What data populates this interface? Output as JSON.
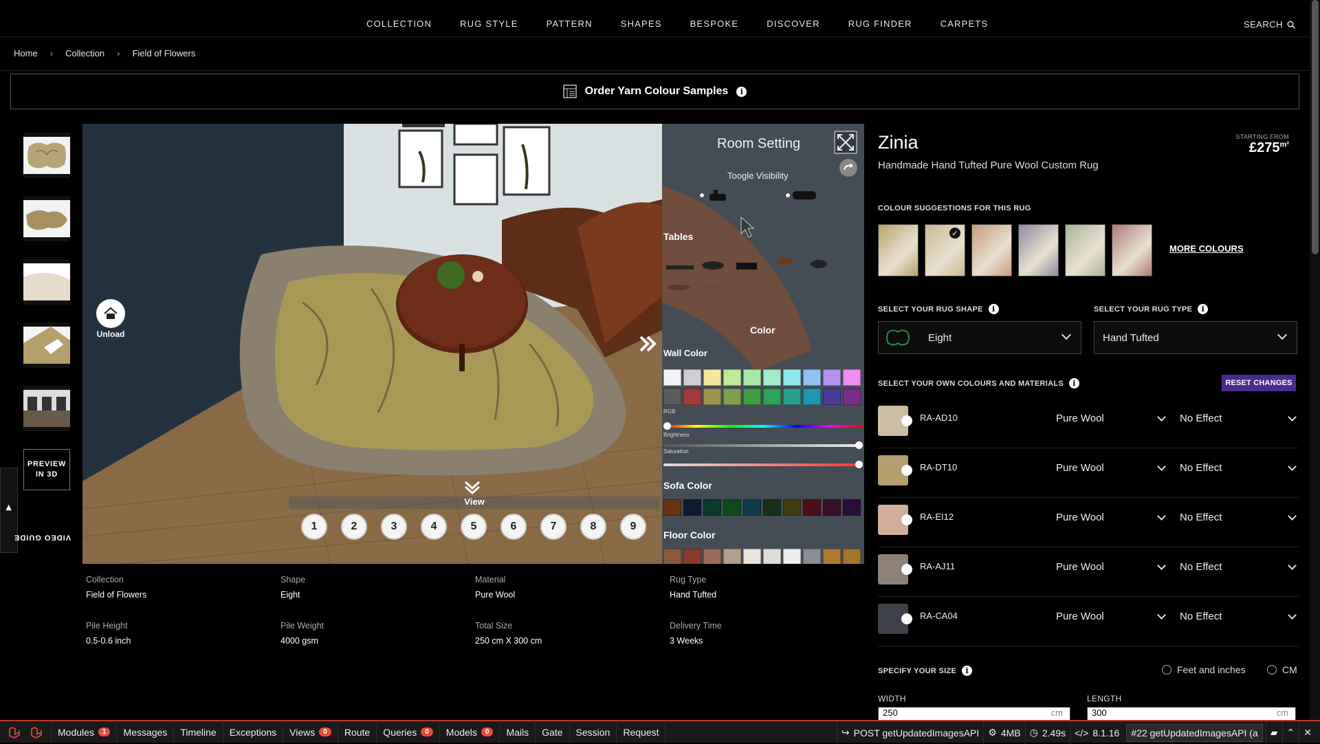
{
  "nav": {
    "items": [
      "COLLECTION",
      "RUG STYLE",
      "PATTERN",
      "SHAPES",
      "BESPOKE",
      "DISCOVER",
      "RUG FINDER",
      "CARPETS"
    ],
    "search_label": "SEARCH"
  },
  "breadcrumb": [
    "Home",
    "Collection",
    "Field of Flowers"
  ],
  "yarn_samples": {
    "label": "Order Yarn Colour Samples"
  },
  "thumbnails": {
    "preview_label_1": "PREVIEW",
    "preview_label_2": "IN 3D"
  },
  "video_guide": "VIDEO GUIDE",
  "viewer": {
    "unload_label": "Unload",
    "panel_title": "Room Setting",
    "toggle_visibility": "Toogle Visibility",
    "tables_label": "Tables",
    "color_label": "Color",
    "wall_color_label": "Wall Color",
    "rgb_label": "RGB",
    "brightness_label": "Brightness",
    "saturation_label": "Saturation",
    "sofa_color_label": "Sofa Color",
    "floor_color_label": "Floor Color",
    "view_label": "View",
    "camera_views": [
      "1",
      "2",
      "3",
      "4",
      "5",
      "6",
      "7",
      "8",
      "9"
    ],
    "wall_colors_row1": [
      "#f2f2f2",
      "#cfcfcf",
      "#f3e79a",
      "#bdeb98",
      "#a5e8a8",
      "#a3eccb",
      "#8ee8ee",
      "#8fc4f0",
      "#b592f2",
      "#ef8ef0"
    ],
    "wall_colors_row2": [
      "#5c5c5c",
      "#a53a3a",
      "#9e9450",
      "#7ea04e",
      "#3f9d42",
      "#2da35b",
      "#2a9e8e",
      "#2296b0",
      "#4a3a9c",
      "#7b2d88"
    ],
    "sofa_colors": [
      "#6b2f12",
      "#0f1a33",
      "#0c3a2c",
      "#0c4a1a",
      "#0f3a4a",
      "#173018",
      "#3d3b10",
      "#4a0f17",
      "#3a0f2a",
      "#2a0f3a"
    ],
    "floor_colors": [
      "#8a5a3a",
      "#8a3a2a",
      "#9a6a5a",
      "#b4a090",
      "#e9e4de",
      "#dedcd6",
      "#ededed",
      "#8a8f94",
      "#b07a30",
      "#a67530"
    ]
  },
  "specs": [
    {
      "key": "Collection",
      "value": "Field of Flowers"
    },
    {
      "key": "Shape",
      "value": "Eight"
    },
    {
      "key": "Material",
      "value": "Pure Wool"
    },
    {
      "key": "Rug Type",
      "value": "Hand Tufted"
    },
    {
      "key": "Pile Height",
      "value": "0.5-0.6 inch"
    },
    {
      "key": "Pile Weight",
      "value": "4000 gsm"
    },
    {
      "key": "Total Size",
      "value": "250 cm X 300 cm"
    },
    {
      "key": "Delivery Time",
      "value": "3 Weeks"
    }
  ],
  "product": {
    "name": "Zinia",
    "subtitle": "Handmade Hand Tufted Pure Wool Custom Rug",
    "starting_from": "STARTING FROM",
    "price": "£275",
    "price_unit": "m²"
  },
  "colour_suggestions": {
    "title": "COLOUR SUGGESTIONS FOR THIS RUG",
    "more_label": "MORE COLOURS",
    "swatches": [
      "#b9a36a",
      "#c7b98f",
      "#c99a7a",
      "#8f8aa0",
      "#a8b59a",
      "#b07a78"
    ]
  },
  "shape_select": {
    "title": "SELECT YOUR RUG SHAPE",
    "value": "Eight"
  },
  "type_select": {
    "title": "SELECT YOUR RUG TYPE",
    "value": "Hand Tufted"
  },
  "colours": {
    "title": "SELECT YOUR OWN COLOURS AND MATERIALS",
    "reset_label": "RESET CHANGES",
    "rows": [
      {
        "code": "RA-AD10",
        "material": "Pure Wool",
        "effect": "No Effect",
        "color": "#cdbda2"
      },
      {
        "code": "RA-DT10",
        "material": "Pure Wool",
        "effect": "No Effect",
        "color": "#b59e6d"
      },
      {
        "code": "RA-EI12",
        "material": "Pure Wool",
        "effect": "No Effect",
        "color": "#d1ad9a"
      },
      {
        "code": "RA-AJ11",
        "material": "Pure Wool",
        "effect": "No Effect",
        "color": "#8e8278"
      },
      {
        "code": "RA-CA04",
        "material": "Pure Wool",
        "effect": "No Effect",
        "color": "#3e4248"
      }
    ]
  },
  "size": {
    "title": "SPECIFY YOUR SIZE",
    "unit_feet": "Feet and inches",
    "unit_cm": "CM",
    "width_label": "WIDTH",
    "length_label": "LENGTH",
    "width_value": "250",
    "length_value": "300",
    "unit_suffix": "cm"
  },
  "debugbar": {
    "items": [
      {
        "label": "Modules",
        "badge": "1"
      },
      {
        "label": "Messages",
        "badge": ""
      },
      {
        "label": "Timeline",
        "badge": ""
      },
      {
        "label": "Exceptions",
        "badge": ""
      },
      {
        "label": "Views",
        "badge": "0"
      },
      {
        "label": "Route",
        "badge": ""
      },
      {
        "label": "Queries",
        "badge": "0"
      },
      {
        "label": "Models",
        "badge": "0"
      },
      {
        "label": "Mails",
        "badge": ""
      },
      {
        "label": "Gate",
        "badge": ""
      },
      {
        "label": "Session",
        "badge": ""
      },
      {
        "label": "Request",
        "badge": ""
      }
    ],
    "request": "POST getUpdatedImagesAPI",
    "memory": "4MB",
    "time": "2.49s",
    "php": "8.1.16",
    "request_select": "#22 getUpdatedImagesAPI (a"
  }
}
